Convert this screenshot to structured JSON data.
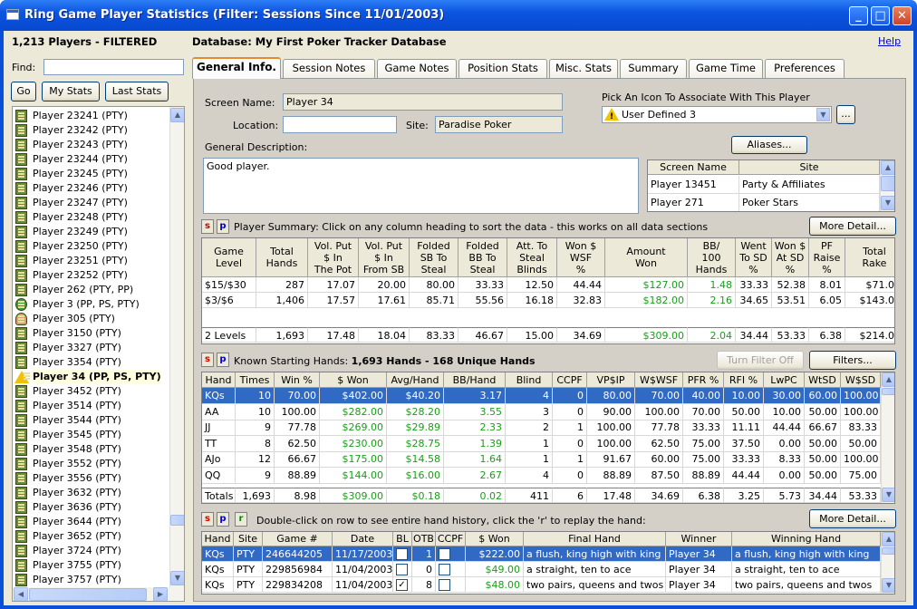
{
  "window": {
    "title": "Ring Game Player Statistics (Filter: Sessions Since 11/01/2003)"
  },
  "header": {
    "players": "1,213 Players - FILTERED",
    "database": "Database: My First Poker Tracker Database",
    "help": "Help"
  },
  "find": {
    "label": "Find:",
    "value": ""
  },
  "buttons": {
    "go": "Go",
    "my_stats": "My Stats",
    "last_stats": "Last Stats"
  },
  "players": [
    {
      "name": "Player 23241 (PTY)",
      "icon": "notebook-icon"
    },
    {
      "name": "Player 23242 (PTY)",
      "icon": "notebook-icon"
    },
    {
      "name": "Player 23243 (PTY)",
      "icon": "notebook-icon"
    },
    {
      "name": "Player 23244 (PTY)",
      "icon": "notebook-icon"
    },
    {
      "name": "Player 23245 (PTY)",
      "icon": "notebook-icon"
    },
    {
      "name": "Player 23246 (PTY)",
      "icon": "notebook-icon"
    },
    {
      "name": "Player 23247 (PTY)",
      "icon": "notebook-icon"
    },
    {
      "name": "Player 23248 (PTY)",
      "icon": "notebook-icon"
    },
    {
      "name": "Player 23249 (PTY)",
      "icon": "notebook-icon"
    },
    {
      "name": "Player 23250 (PTY)",
      "icon": "notebook-icon"
    },
    {
      "name": "Player 23251 (PTY)",
      "icon": "notebook-icon"
    },
    {
      "name": "Player 23252 (PTY)",
      "icon": "notebook-icon"
    },
    {
      "name": "Player 262 (PTY, PP)",
      "icon": "notebook-icon"
    },
    {
      "name": "Player 3 (PP, PS, PTY)",
      "icon": "money-bag-icon"
    },
    {
      "name": "Player 305 (PTY)",
      "icon": "person-icon"
    },
    {
      "name": "Player 3150 (PTY)",
      "icon": "notebook-icon"
    },
    {
      "name": "Player 3327 (PTY)",
      "icon": "notebook-icon"
    },
    {
      "name": "Player 3354 (PTY)",
      "icon": "notebook-icon"
    },
    {
      "name": "Player 34 (PP, PS, PTY)",
      "icon": "warning-icon",
      "selected": true
    },
    {
      "name": "Player 3452 (PTY)",
      "icon": "notebook-icon"
    },
    {
      "name": "Player 3514 (PTY)",
      "icon": "notebook-icon"
    },
    {
      "name": "Player 3544 (PTY)",
      "icon": "notebook-icon"
    },
    {
      "name": "Player 3545 (PTY)",
      "icon": "notebook-icon"
    },
    {
      "name": "Player 3548 (PTY)",
      "icon": "notebook-icon"
    },
    {
      "name": "Player 3552 (PTY)",
      "icon": "notebook-icon"
    },
    {
      "name": "Player 3556 (PTY)",
      "icon": "notebook-icon"
    },
    {
      "name": "Player 3632 (PTY)",
      "icon": "notebook-icon"
    },
    {
      "name": "Player 3636 (PTY)",
      "icon": "notebook-icon"
    },
    {
      "name": "Player 3644 (PTY)",
      "icon": "notebook-icon"
    },
    {
      "name": "Player 3652 (PTY)",
      "icon": "notebook-icon"
    },
    {
      "name": "Player 3724 (PTY)",
      "icon": "notebook-icon"
    },
    {
      "name": "Player 3755 (PTY)",
      "icon": "notebook-icon"
    },
    {
      "name": "Player 3757 (PTY)",
      "icon": "notebook-icon"
    }
  ],
  "tabs": [
    "General Info.",
    "Session Notes",
    "Game Notes",
    "Position Stats",
    "Misc. Stats",
    "Summary",
    "Game Time",
    "Preferences"
  ],
  "general": {
    "screen_name_label": "Screen Name:",
    "screen_name": "Player 34",
    "location_label": "Location:",
    "location": "",
    "site_label": "Site:",
    "site": "Paradise Poker",
    "icon_label": "Pick An Icon To Associate With This Player",
    "icon_value": "User Defined 3",
    "icon_more": "...",
    "aliases_button": "Aliases...",
    "description_label": "General Description:",
    "description": "Good player."
  },
  "aliases": {
    "columns": [
      "Screen Name",
      "Site"
    ],
    "rows": [
      [
        "Player 13451",
        "Party & Affiliates"
      ],
      [
        "Player 271",
        "Poker Stars"
      ]
    ]
  },
  "summary": {
    "s": "s",
    "p": "p",
    "title": "Player Summary: Click on any column heading to sort the data - this works on all data sections",
    "more_button": "More Detail...",
    "columns": [
      "Game\nLevel",
      "Total\nHands",
      "Vol. Put\n$ In\nThe Pot",
      "Vol. Put\n$ In\nFrom SB",
      "Folded\nSB To\nSteal",
      "Folded\nBB To\nSteal",
      "Att. To\nSteal\nBlinds",
      "Won $\nWSF\n%",
      "Amount\nWon",
      "BB/\n100\nHands",
      "Went\nTo SD\n%",
      "Won $\nAt SD\n%",
      "PF\nRaise\n%",
      "Total\nRake"
    ],
    "rows": [
      [
        "$15/$30",
        "287",
        "17.07",
        "20.00",
        "80.00",
        "33.33",
        "12.50",
        "44.44",
        "$127.00",
        "1.48",
        "33.33",
        "52.38",
        "8.01",
        "$71.00"
      ],
      [
        "$3/$6",
        "1,406",
        "17.57",
        "17.61",
        "85.71",
        "55.56",
        "16.18",
        "32.83",
        "$182.00",
        "2.16",
        "34.65",
        "53.51",
        "6.05",
        "$143.00"
      ]
    ],
    "totals": [
      "2 Levels",
      "1,693",
      "17.48",
      "18.04",
      "83.33",
      "46.67",
      "15.00",
      "34.69",
      "$309.00",
      "2.04",
      "34.44",
      "53.33",
      "6.38",
      "$214.00"
    ]
  },
  "hands": {
    "s": "s",
    "p": "p",
    "title_prefix": "Known Starting Hands:",
    "title_bold": "1,693 Hands - 168 Unique Hands",
    "turn_filter_off": "Turn Filter Off",
    "filters": "Filters...",
    "columns": [
      "Hand",
      "Times",
      "Win %",
      "$ Won",
      "Avg/Hand",
      "BB/Hand",
      "Blind",
      "CCPF",
      "VP$IP",
      "W$WSF",
      "PFR %",
      "RFI %",
      "LwPC",
      "WtSD",
      "W$SD"
    ],
    "rows": [
      [
        "KQs",
        "10",
        "70.00",
        "$402.00",
        "$40.20",
        "3.17",
        "4",
        "0",
        "80.00",
        "70.00",
        "40.00",
        "10.00",
        "30.00",
        "60.00",
        "100.00"
      ],
      [
        "AA",
        "10",
        "100.00",
        "$282.00",
        "$28.20",
        "3.55",
        "3",
        "0",
        "90.00",
        "100.00",
        "70.00",
        "50.00",
        "10.00",
        "50.00",
        "100.00"
      ],
      [
        "JJ",
        "9",
        "77.78",
        "$269.00",
        "$29.89",
        "2.33",
        "2",
        "1",
        "100.00",
        "77.78",
        "33.33",
        "11.11",
        "44.44",
        "66.67",
        "83.33"
      ],
      [
        "TT",
        "8",
        "62.50",
        "$230.00",
        "$28.75",
        "1.39",
        "1",
        "0",
        "100.00",
        "62.50",
        "75.00",
        "37.50",
        "0.00",
        "50.00",
        "50.00"
      ],
      [
        "AJo",
        "12",
        "66.67",
        "$175.00",
        "$14.58",
        "1.64",
        "1",
        "1",
        "91.67",
        "60.00",
        "75.00",
        "33.33",
        "8.33",
        "50.00",
        "100.00"
      ],
      [
        "QQ",
        "9",
        "88.89",
        "$144.00",
        "$16.00",
        "2.67",
        "4",
        "0",
        "88.89",
        "87.50",
        "88.89",
        "44.44",
        "0.00",
        "50.00",
        "75.00"
      ]
    ],
    "totals": [
      "Totals",
      "1,693",
      "8.98",
      "$309.00",
      "$0.18",
      "0.02",
      "411",
      "6",
      "17.48",
      "34.69",
      "6.38",
      "3.25",
      "5.73",
      "34.44",
      "53.33"
    ]
  },
  "history": {
    "s": "s",
    "p": "p",
    "r": "r",
    "title": "Double-click on row to see entire hand history, click the 'r' to replay the hand:",
    "more_button": "More Detail...",
    "columns": [
      "Hand",
      "Site",
      "Game #",
      "Date",
      "BL",
      "OTB",
      "CCPF",
      "$ Won",
      "Final Hand",
      "Winner",
      "Winning Hand"
    ],
    "rows": [
      {
        "hand": "KQs",
        "site": "PTY",
        "game": "246644205",
        "date": "11/17/2003",
        "bl": false,
        "otb": "1",
        "ccpf": false,
        "won": "$222.00",
        "final": "a flush, king high with king",
        "winner": "Player 34",
        "winning": "a flush, king high with king"
      },
      {
        "hand": "KQs",
        "site": "PTY",
        "game": "229856984",
        "date": "11/04/2003",
        "bl": false,
        "otb": "0",
        "ccpf": false,
        "won": "$49.00",
        "final": "a straight, ten to ace",
        "winner": "Player 34",
        "winning": "a straight, ten to ace"
      },
      {
        "hand": "KQs",
        "site": "PTY",
        "game": "229834208",
        "date": "11/04/2003",
        "bl": true,
        "otb": "8",
        "ccpf": false,
        "won": "$48.00",
        "final": "two pairs, queens and twos",
        "winner": "Player 34",
        "winning": "two pairs, queens and twos"
      }
    ]
  },
  "colors": {
    "selection": "#316ac5",
    "money_green": "#18a018",
    "tab_accent": "#e68b2c"
  }
}
